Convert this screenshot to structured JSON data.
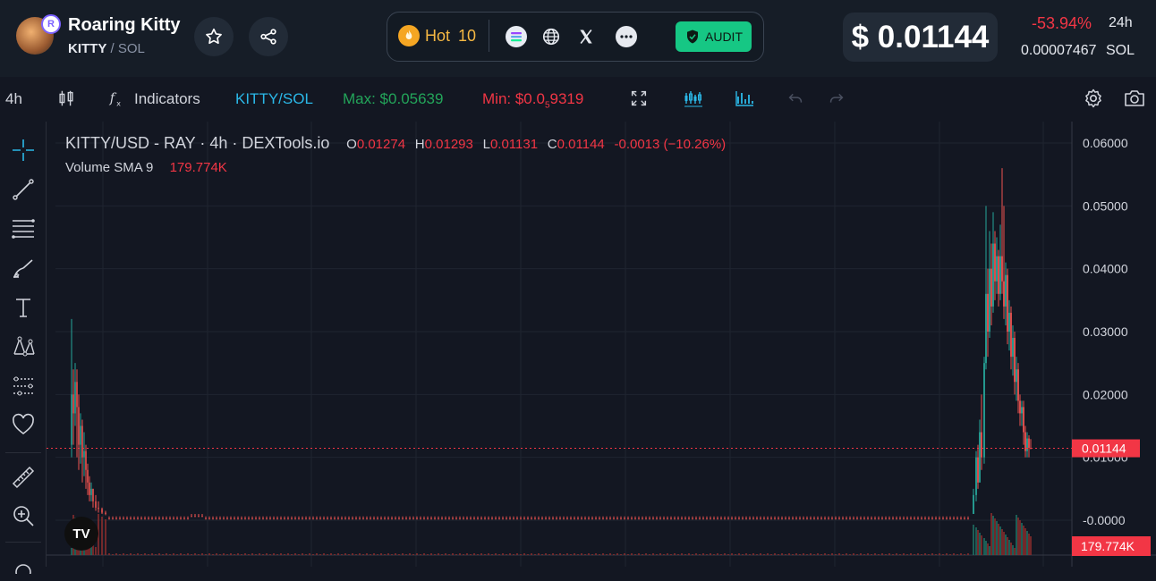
{
  "header": {
    "token_name": "Roaring Kitty",
    "token_symbol": "KITTY",
    "pair_separator": "/",
    "pair_quote": "SOL",
    "badge_letter": "R",
    "hot_label": "Hot",
    "hot_rank": "10",
    "audit_label": "AUDIT",
    "price_usd": "$ 0.01144",
    "price_change": "-53.94%",
    "price_change_period": "24h",
    "price_sol": "0.00007467",
    "price_sol_unit": "SOL"
  },
  "toolbar": {
    "timeframe": "4h",
    "indicators_label": "Indicators",
    "pair_label": "KITTY/SOL",
    "max_label": "Max: $0.05639",
    "min_label": "Min: $0.0",
    "min_subscript": "5",
    "min_tail": "9319"
  },
  "legend": {
    "symbol_line": "KITTY/USD - RAY · 4h · DEXTools.io",
    "o_label": "O",
    "o_value": "0.01274",
    "h_label": "H",
    "h_value": "0.01293",
    "l_label": "L",
    "l_value": "0.01131",
    "c_label": "C",
    "c_value": "0.01144",
    "change": "-0.0013 (−10.26%)",
    "volume_label": "Volume SMA 9",
    "volume_value": "179.774K"
  },
  "chart_data": {
    "type": "candlestick",
    "y_ticks": [
      "0.06000",
      "0.05000",
      "0.04000",
      "0.03000",
      "0.02000",
      "0.01000",
      "-0.0000"
    ],
    "ylim": [
      0,
      0.06
    ],
    "current_price_label": "0.01144",
    "current_price": 0.01144,
    "volume_label": "179.774K",
    "colors": {
      "up": "#26a69a",
      "down": "#ef5350",
      "grid": "#1f2430"
    }
  },
  "colors": {
    "positive": "#16c784",
    "negative": "#f23645",
    "accent": "#2bb8e8",
    "background": "#131722"
  },
  "tv_logo_text": "TV"
}
